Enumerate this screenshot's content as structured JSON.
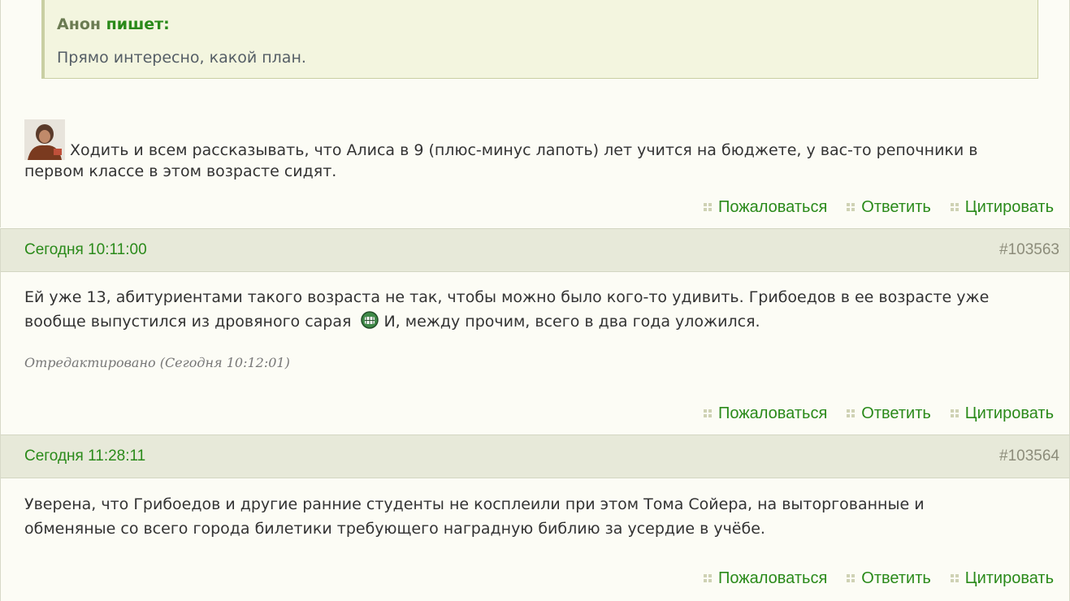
{
  "post1": {
    "quote_author": "Анон",
    "quote_verb": "пишет:",
    "quote_text": "Прямо интересно, какой план.",
    "text_line1": "Ходить и всем рассказывать, что Алиса в 9 (плюс-минус лапоть) лет учится на бюджете, у вас-то репочники в",
    "text_line2": "первом классе в этом возрасте сидят."
  },
  "post2": {
    "date": "Сегодня 10:11:00",
    "number": "#103563",
    "text_line1": "Ей уже 13, абитуриентами такого возраста не так, чтобы можно было кого-то удивить. Грибоедов в ее возрасте уже",
    "text_line2a": "вообще выпустился из дровяного сарая",
    "text_line2b": "И, между прочим, всего в  два года уложился.",
    "edited": "Отредактировано (Сегодня 10:12:01)"
  },
  "post3": {
    "date": "Сегодня 11:28:11",
    "number": "#103564",
    "text_line1": "Уверена, что Грибоедов и другие ранние студенты не косплеили при этом Тома Сойера, на выторгованные и",
    "text_line2": "обменяные со всего города билетики требующего наградную библию за усердие в учёбе."
  },
  "actions": {
    "report": "Пожаловаться",
    "reply": "Ответить",
    "quote": "Цитировать"
  },
  "colors": {
    "link_green": "#2a8a1a",
    "header_bg": "#e7e9d9",
    "quote_bg": "#f3f5df"
  }
}
